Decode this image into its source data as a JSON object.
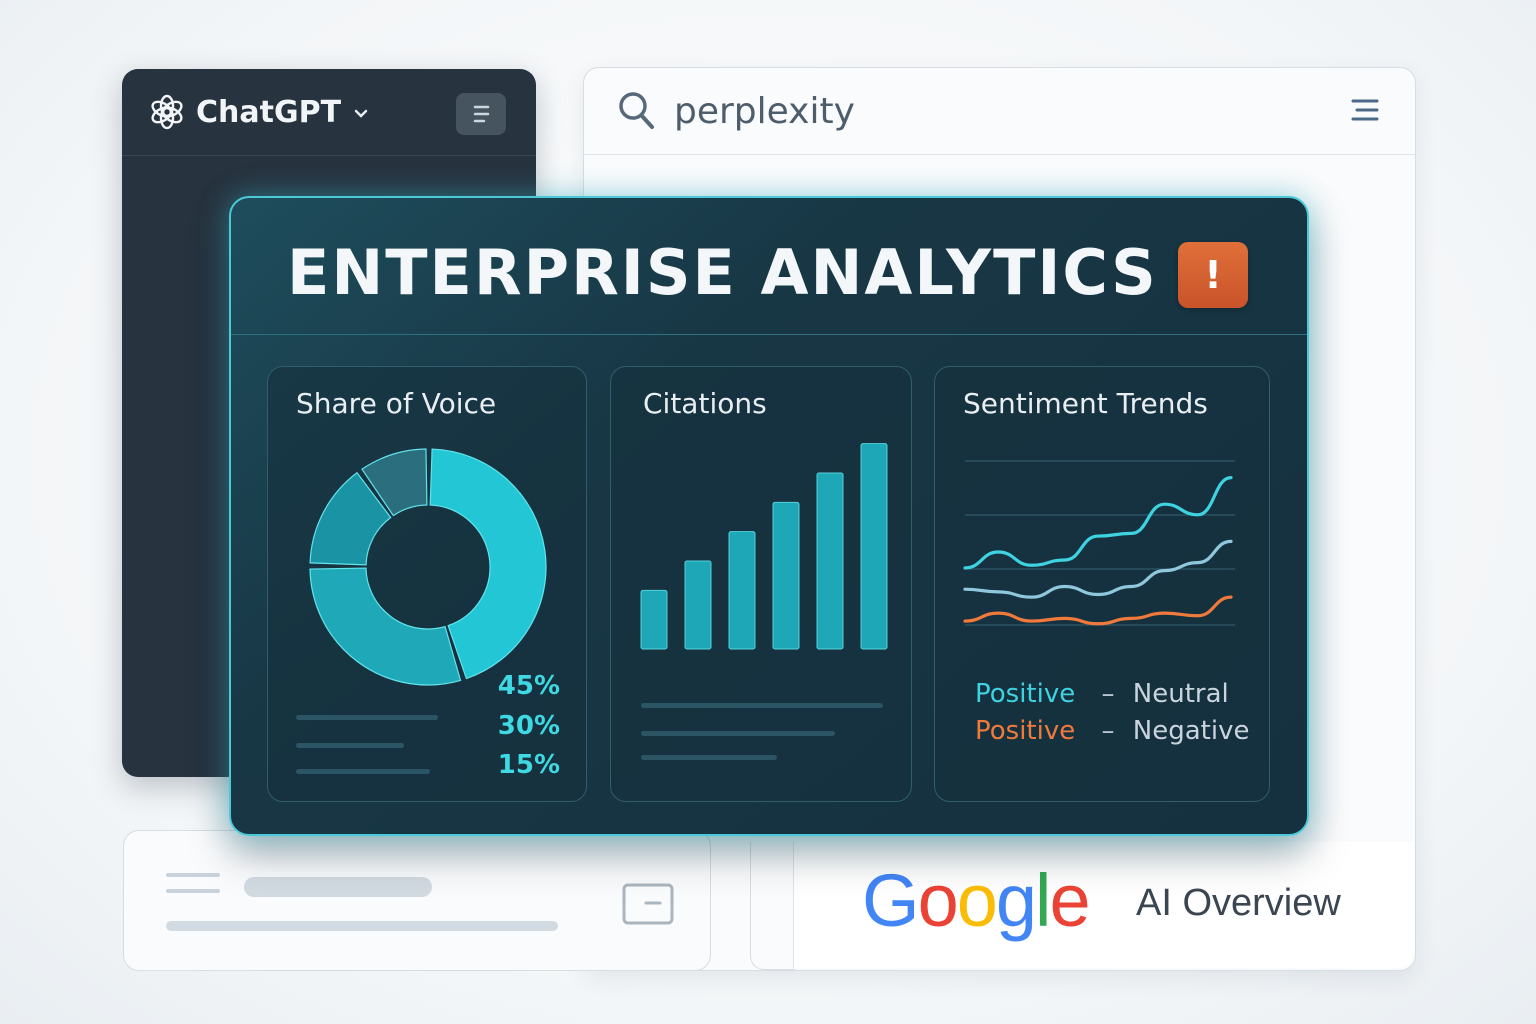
{
  "chatgpt": {
    "title": "ChatGPT",
    "icon": "openai-logo-icon",
    "dropdown_icon": "chevron-down-icon",
    "menu_icon": "menu-icon"
  },
  "perplexity": {
    "title": "perplexity",
    "search_icon": "search-icon",
    "menu_icon": "hamburger-icon"
  },
  "google": {
    "logo_text": "Google",
    "label": "AI Overview",
    "colors": [
      "#4285F4",
      "#EA4335",
      "#FBBC05",
      "#4285F4",
      "#34A853",
      "#EA4335"
    ]
  },
  "dashboard": {
    "title": "ENTERPRISE ANALYTICS",
    "alert_label": "!",
    "accent": "#4cc9d6",
    "alert_color": "#d9602f",
    "share_of_voice": {
      "title": "Share of Voice",
      "percents": [
        "45%",
        "30%",
        "15%"
      ]
    },
    "citations": {
      "title": "Citations"
    },
    "sentiment": {
      "title": "Sentiment Trends",
      "legend": [
        {
          "left": "Positive",
          "sep": "–",
          "right": "Neutral",
          "color": "#3fd2e0"
        },
        {
          "left": "Positive",
          "sep": "–",
          "right": "Negative",
          "color": "#f07a3c"
        }
      ]
    }
  },
  "chart_data": [
    {
      "type": "pie",
      "title": "Share of Voice",
      "values": [
        45,
        30,
        15,
        10
      ],
      "labels": [
        "45%",
        "30%",
        "15%"
      ]
    },
    {
      "type": "bar",
      "title": "Citations",
      "values": [
        2,
        3,
        4,
        5,
        6,
        7
      ],
      "ylim": [
        0,
        7.5
      ]
    },
    {
      "type": "line",
      "title": "Sentiment Trends",
      "x": [
        0,
        1,
        2,
        3,
        4,
        5,
        6,
        7,
        8
      ],
      "series": [
        {
          "values": [
            2.6,
            3.2,
            2.7,
            2.9,
            3.8,
            3.9,
            5.0,
            4.6,
            6.0
          ],
          "color": "#3fd2e0"
        },
        {
          "values": [
            1.8,
            1.7,
            1.5,
            1.9,
            1.6,
            1.9,
            2.5,
            2.8,
            3.6
          ],
          "color": "#8fc8dc"
        },
        {
          "values": [
            0.6,
            0.9,
            0.6,
            0.7,
            0.5,
            0.7,
            0.9,
            0.8,
            1.5
          ],
          "color": "#f07a3c"
        }
      ]
    }
  ]
}
